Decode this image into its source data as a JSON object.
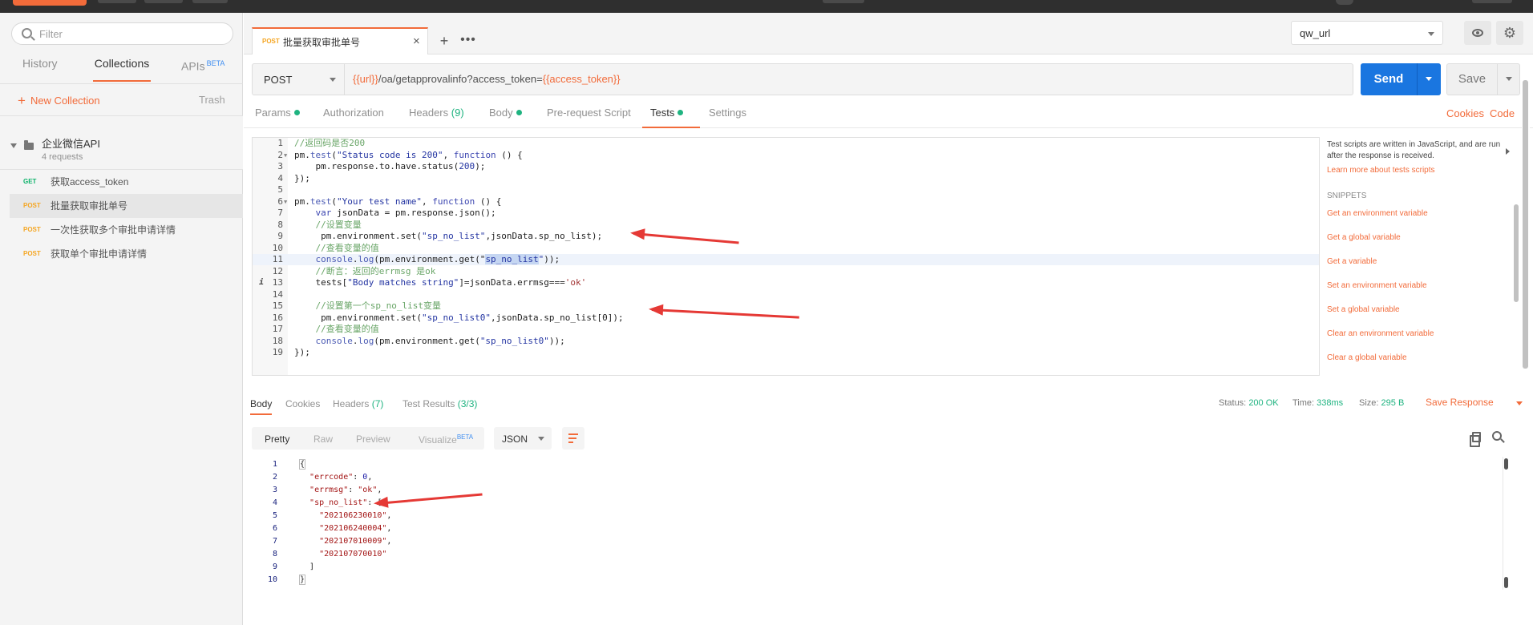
{
  "sidebar": {
    "filter_placeholder": "Filter",
    "tabs": [
      {
        "label": "History"
      },
      {
        "label": "Collections"
      },
      {
        "label": "APIs",
        "badge": "BETA"
      }
    ],
    "new_collection": "New Collection",
    "trash": "Trash",
    "collection": {
      "name": "企业微信API",
      "count": "4 requests"
    },
    "requests": [
      {
        "method": "GET",
        "name": "获取access_token"
      },
      {
        "method": "POST",
        "name": "批量获取审批单号"
      },
      {
        "method": "POST",
        "name": "一次性获取多个审批申请详情"
      },
      {
        "method": "POST",
        "name": "获取单个审批申请详情"
      }
    ]
  },
  "tabbar": {
    "tab_method": "POST",
    "tab_title": "批量获取审批单号",
    "close": "×",
    "add": "+",
    "more": "•••",
    "environment": "qw_url"
  },
  "request": {
    "method": "POST",
    "url_var1": "{{url}}",
    "url_path": "/oa/getapprovalinfo?access_token=",
    "url_var2": "{{access_token}}",
    "send": "Send",
    "save": "Save"
  },
  "subtabs": {
    "params": "Params",
    "authorization": "Authorization",
    "headers": "Headers",
    "headers_count": "(9)",
    "body": "Body",
    "prerequest": "Pre-request Script",
    "tests": "Tests",
    "settings": "Settings",
    "cookies": "Cookies",
    "code": "Code"
  },
  "editor_lines": [
    {
      "n": "1",
      "fold": "",
      "parts": [
        [
          "c-cm",
          "//返回码是否200"
        ]
      ]
    },
    {
      "n": "2",
      "fold": "▼",
      "parts": [
        [
          "",
          "pm."
        ],
        [
          "c-fn",
          "test"
        ],
        [
          "",
          "("
        ],
        [
          "c-st",
          "\"Status code is 200\""
        ],
        [
          "",
          ", "
        ],
        [
          "c-kw",
          "function"
        ],
        [
          "",
          " () {"
        ]
      ]
    },
    {
      "n": "3",
      "fold": "",
      "parts": [
        [
          "",
          "    pm.response.to.have.status("
        ],
        [
          "c-st",
          "200"
        ],
        [
          "",
          ");"
        ]
      ]
    },
    {
      "n": "4",
      "fold": "",
      "parts": [
        [
          "",
          "});"
        ]
      ]
    },
    {
      "n": "5",
      "fold": "",
      "parts": [
        [
          "",
          ""
        ]
      ]
    },
    {
      "n": "6",
      "fold": "▼",
      "parts": [
        [
          "",
          "pm."
        ],
        [
          "c-fn",
          "test"
        ],
        [
          "",
          "("
        ],
        [
          "c-st",
          "\"Your test name\""
        ],
        [
          "",
          ", "
        ],
        [
          "c-kw",
          "function"
        ],
        [
          "",
          " () {"
        ]
      ]
    },
    {
      "n": "7",
      "fold": "",
      "parts": [
        [
          "",
          "    "
        ],
        [
          "c-kw",
          "var"
        ],
        [
          "",
          " jsonData = pm.response.json();"
        ]
      ]
    },
    {
      "n": "8",
      "fold": "",
      "parts": [
        [
          "",
          "    "
        ],
        [
          "c-cm",
          "//设置变量"
        ]
      ]
    },
    {
      "n": "9",
      "fold": "",
      "parts": [
        [
          "",
          "     pm.environment.set("
        ],
        [
          "c-st",
          "\"sp_no_list\""
        ],
        [
          "",
          ",jsonData.sp_no_list);"
        ]
      ]
    },
    {
      "n": "10",
      "fold": "",
      "parts": [
        [
          "",
          "    "
        ],
        [
          "c-cm",
          "//查看变量的值"
        ]
      ]
    },
    {
      "n": "11",
      "fold": "",
      "parts": [
        [
          "",
          "    "
        ],
        [
          "c-fn",
          "console"
        ],
        [
          "",
          "."
        ],
        [
          "c-fn",
          "log"
        ],
        [
          "",
          "(pm.environment.get(\""
        ],
        [
          "sel c-st",
          "sp_no_list"
        ],
        [
          "c-st",
          "\""
        ],
        [
          "",
          "));"
        ]
      ]
    },
    {
      "n": "12",
      "fold": "",
      "parts": [
        [
          "",
          "    "
        ],
        [
          "c-cm",
          "//断言：返回的errmsg 是ok"
        ]
      ]
    },
    {
      "n": "13",
      "fold": "",
      "parts": [
        [
          "",
          "    tests["
        ],
        [
          "c-st",
          "\"Body matches string\""
        ],
        [
          "",
          "]=jsonData.errmsg==="
        ],
        [
          "c-sq",
          "'ok'"
        ]
      ]
    },
    {
      "n": "14",
      "fold": "",
      "parts": [
        [
          "",
          ""
        ]
      ]
    },
    {
      "n": "15",
      "fold": "",
      "parts": [
        [
          "",
          "    "
        ],
        [
          "c-cm",
          "//设置第一个sp_no_list变量"
        ]
      ]
    },
    {
      "n": "16",
      "fold": "",
      "parts": [
        [
          "",
          "     pm.environment.set("
        ],
        [
          "c-st",
          "\"sp_no_list0\""
        ],
        [
          "",
          ",jsonData.sp_no_list[0]);"
        ]
      ]
    },
    {
      "n": "17",
      "fold": "",
      "parts": [
        [
          "",
          "    "
        ],
        [
          "c-cm",
          "//查看变量的值"
        ]
      ]
    },
    {
      "n": "18",
      "fold": "",
      "parts": [
        [
          "",
          "    "
        ],
        [
          "c-fn",
          "console"
        ],
        [
          "",
          "."
        ],
        [
          "c-fn",
          "log"
        ],
        [
          "",
          "(pm.environment.get("
        ],
        [
          "c-st",
          "\"sp_no_list0\""
        ],
        [
          "",
          "));"
        ]
      ]
    },
    {
      "n": "19",
      "fold": "",
      "parts": [
        [
          "",
          "});"
        ]
      ]
    }
  ],
  "snippets": {
    "description": "Test scripts are written in JavaScript, and are run after the response is received.",
    "learn_more": "Learn more about tests scripts",
    "heading": "SNIPPETS",
    "items": [
      "Get an environment variable",
      "Get a global variable",
      "Get a variable",
      "Set an environment variable",
      "Set a global variable",
      "Clear an environment variable",
      "Clear a global variable"
    ]
  },
  "response": {
    "tabs": {
      "body": "Body",
      "cookies": "Cookies",
      "headers": "Headers",
      "headers_count": "(7)",
      "test_results": "Test Results",
      "test_results_count": "(3/3)"
    },
    "status_label": "Status:",
    "status_value": "200 OK",
    "time_label": "Time:",
    "time_value": "338ms",
    "size_label": "Size:",
    "size_value": "295 B",
    "save_response": "Save Response",
    "formats": {
      "pretty": "Pretty",
      "raw": "Raw",
      "preview": "Preview",
      "visualize": "Visualize",
      "beta": "BETA"
    },
    "format_select": "JSON",
    "lines": [
      {
        "n": "1",
        "parts": [
          [
            "bracket",
            "{"
          ]
        ]
      },
      {
        "n": "2",
        "parts": [
          [
            "",
            "  "
          ],
          [
            "j-k",
            "\"errcode\""
          ],
          [
            "",
            ": "
          ],
          [
            "j-n",
            "0"
          ],
          [
            "",
            ","
          ]
        ]
      },
      {
        "n": "3",
        "parts": [
          [
            "",
            "  "
          ],
          [
            "j-k",
            "\"errmsg\""
          ],
          [
            "",
            ": "
          ],
          [
            "j-s",
            "\"ok\""
          ],
          [
            "",
            ","
          ]
        ]
      },
      {
        "n": "4",
        "parts": [
          [
            "",
            "  "
          ],
          [
            "j-k",
            "\"sp_no_list\""
          ],
          [
            "",
            ": ["
          ]
        ]
      },
      {
        "n": "5",
        "parts": [
          [
            "",
            "    "
          ],
          [
            "j-s",
            "\"202106230010\""
          ],
          [
            "",
            ","
          ]
        ]
      },
      {
        "n": "6",
        "parts": [
          [
            "",
            "    "
          ],
          [
            "j-s",
            "\"202106240004\""
          ],
          [
            "",
            ","
          ]
        ]
      },
      {
        "n": "7",
        "parts": [
          [
            "",
            "    "
          ],
          [
            "j-s",
            "\"202107010009\""
          ],
          [
            "",
            ","
          ]
        ]
      },
      {
        "n": "8",
        "parts": [
          [
            "",
            "    "
          ],
          [
            "j-s",
            "\"202107070010\""
          ]
        ]
      },
      {
        "n": "9",
        "parts": [
          [
            "",
            "  ]"
          ]
        ]
      },
      {
        "n": "10",
        "parts": [
          [
            "bracket",
            "}"
          ]
        ]
      }
    ]
  },
  "colors": {
    "accent": "#f26b3a",
    "send": "#1a76e0",
    "ok": "#1fb380",
    "arrow": "#e53935"
  }
}
